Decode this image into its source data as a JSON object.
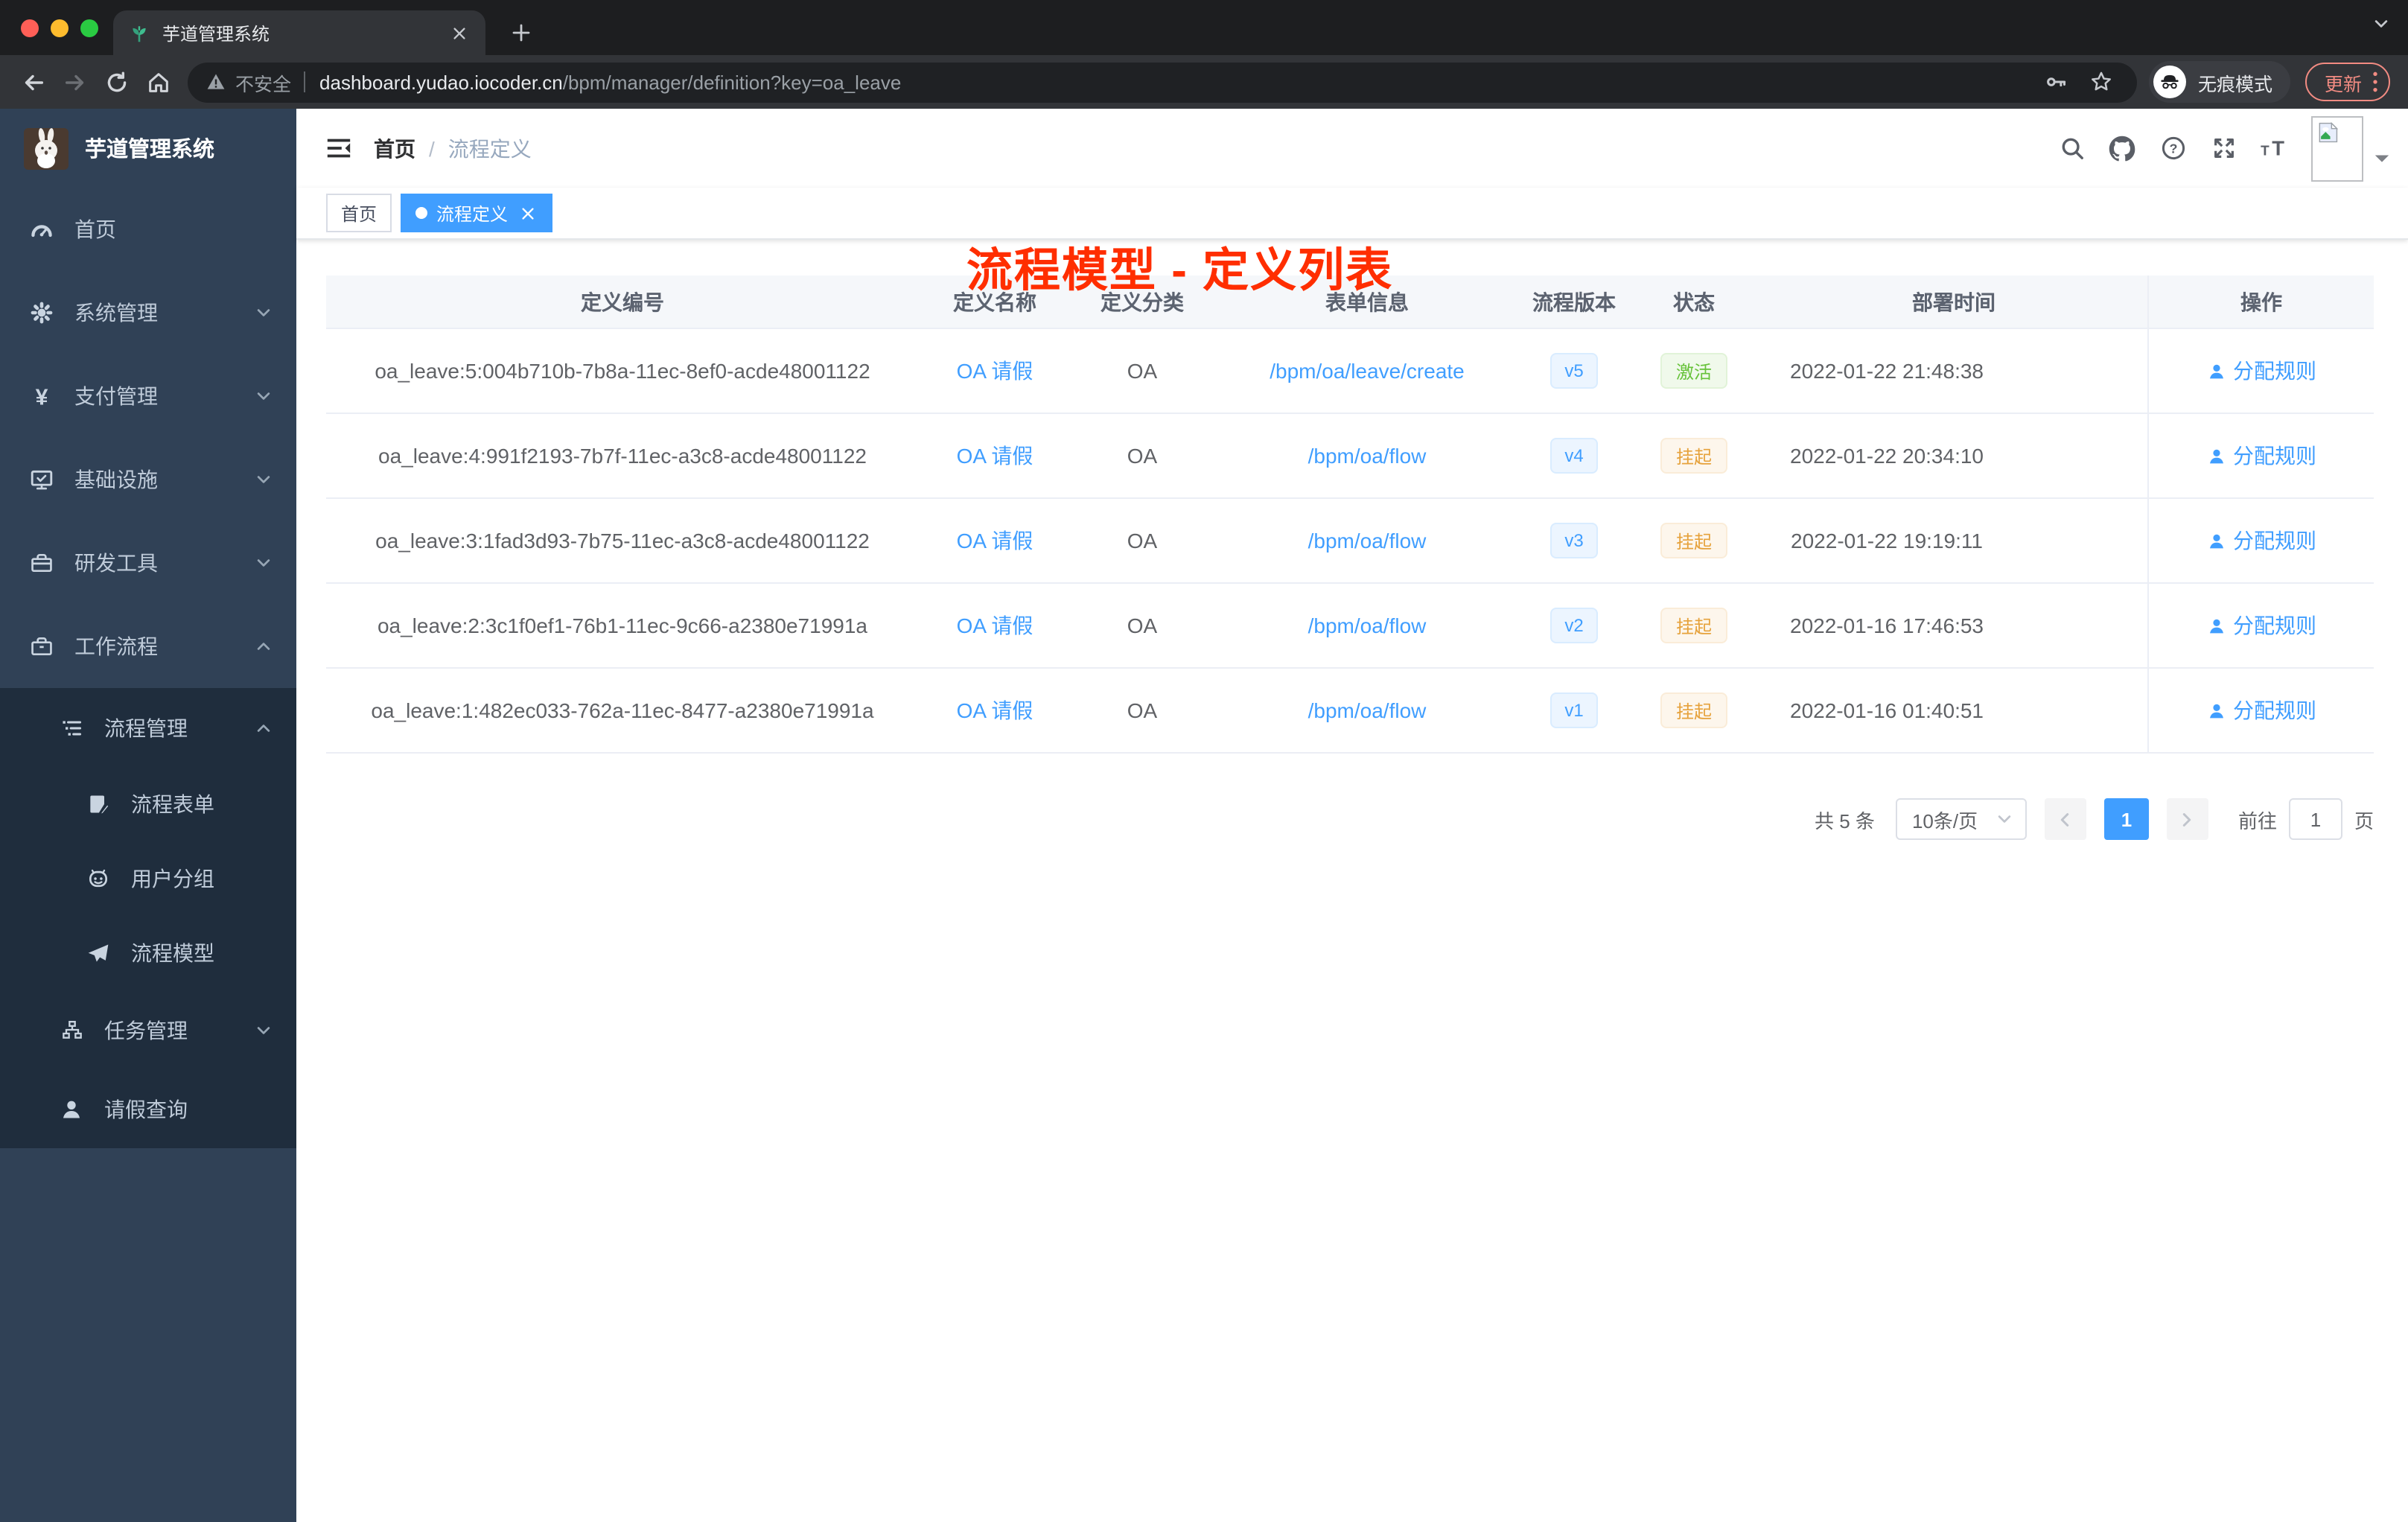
{
  "colors": {
    "primary": "#409EFF",
    "success": "#67C23A",
    "warning": "#E6A23C",
    "annotation_red": "#FF2E00",
    "sidebar_bg": "#304156",
    "sidebar_sub_bg": "#1F2D3D",
    "update_salmon": "#F28B82"
  },
  "browser": {
    "tab": {
      "title": "芋道管理系统",
      "favicon": "plant-favicon"
    },
    "url": {
      "security_label": "不安全",
      "host": "dashboard.yudao.iocoder.cn",
      "path": "/bpm/manager/definition?key=oa_leave"
    },
    "incognito_label": "无痕模式",
    "update_label": "更新"
  },
  "sidebar": {
    "title": "芋道管理系统",
    "menu": [
      {
        "label": "首页",
        "icon": "dashboard-icon",
        "level": 1,
        "chevron": null,
        "sub": false
      },
      {
        "label": "系统管理",
        "icon": "gear-icon",
        "level": 1,
        "chevron": "down",
        "sub": false
      },
      {
        "label": "支付管理",
        "icon": "yen-icon",
        "level": 1,
        "chevron": "down",
        "sub": false
      },
      {
        "label": "基础设施",
        "icon": "monitor-icon",
        "level": 1,
        "chevron": "down",
        "sub": false
      },
      {
        "label": "研发工具",
        "icon": "toolbox-icon",
        "level": 1,
        "chevron": "down",
        "sub": false
      },
      {
        "label": "工作流程",
        "icon": "briefcase-icon",
        "level": 1,
        "chevron": "up",
        "sub": false
      },
      {
        "label": "流程管理",
        "icon": "flow-list-icon",
        "level": 2,
        "chevron": "up",
        "sub": true
      },
      {
        "label": "流程表单",
        "icon": "form-icon",
        "level": 3,
        "chevron": null,
        "sub": true
      },
      {
        "label": "用户分组",
        "icon": "robot-icon",
        "level": 3,
        "chevron": null,
        "sub": true
      },
      {
        "label": "流程模型",
        "icon": "paper-plane-icon",
        "level": 3,
        "chevron": null,
        "sub": true
      },
      {
        "label": "任务管理",
        "icon": "tree-icon",
        "level": 2,
        "chevron": "down",
        "sub": true
      },
      {
        "label": "请假查询",
        "icon": "user-icon",
        "level": 2,
        "chevron": null,
        "sub": true
      }
    ]
  },
  "navbar": {
    "breadcrumb": {
      "first": "首页",
      "separator": "/",
      "current": "流程定义"
    },
    "icons": [
      "search-icon",
      "github-icon",
      "help-icon",
      "fullscreen-icon",
      "font-size-icon"
    ]
  },
  "annotation": {
    "text": "流程模型 - 定义列表"
  },
  "tags": {
    "items": [
      {
        "label": "首页",
        "active": false,
        "closable": false
      },
      {
        "label": "流程定义",
        "active": true,
        "closable": true
      }
    ]
  },
  "table": {
    "columns": [
      "定义编号",
      "定义名称",
      "定义分类",
      "表单信息",
      "流程版本",
      "状态",
      "部署时间",
      "操作"
    ],
    "action_label": "分配规则",
    "rows": [
      {
        "id": "oa_leave:5:004b710b-7b8a-11ec-8ef0-acde48001122",
        "name": "OA 请假",
        "category": "OA",
        "form": "/bpm/oa/leave/create",
        "version": "v5",
        "status": "激活",
        "status_type": "success",
        "deployed_at": "2022-01-22 21:48:38"
      },
      {
        "id": "oa_leave:4:991f2193-7b7f-11ec-a3c8-acde48001122",
        "name": "OA 请假",
        "category": "OA",
        "form": "/bpm/oa/flow",
        "version": "v4",
        "status": "挂起",
        "status_type": "warning",
        "deployed_at": "2022-01-22 20:34:10"
      },
      {
        "id": "oa_leave:3:1fad3d93-7b75-11ec-a3c8-acde48001122",
        "name": "OA 请假",
        "category": "OA",
        "form": "/bpm/oa/flow",
        "version": "v3",
        "status": "挂起",
        "status_type": "warning",
        "deployed_at": "2022-01-22 19:19:11"
      },
      {
        "id": "oa_leave:2:3c1f0ef1-76b1-11ec-9c66-a2380e71991a",
        "name": "OA 请假",
        "category": "OA",
        "form": "/bpm/oa/flow",
        "version": "v2",
        "status": "挂起",
        "status_type": "warning",
        "deployed_at": "2022-01-16 17:46:53"
      },
      {
        "id": "oa_leave:1:482ec033-762a-11ec-8477-a2380e71991a",
        "name": "OA 请假",
        "category": "OA",
        "form": "/bpm/oa/flow",
        "version": "v1",
        "status": "挂起",
        "status_type": "warning",
        "deployed_at": "2022-01-16 01:40:51"
      }
    ]
  },
  "pagination": {
    "total": "共 5 条",
    "page_size": "10条/页",
    "current_page": "1",
    "goto_label": "前往",
    "goto_value": "1",
    "page_unit": "页"
  }
}
